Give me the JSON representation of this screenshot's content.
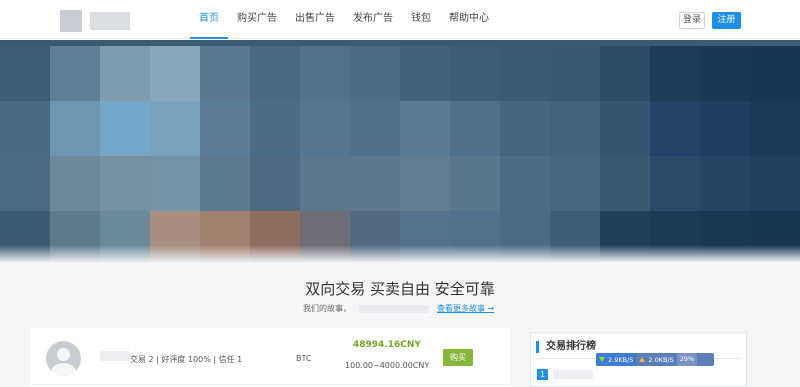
{
  "nav": {
    "items": [
      {
        "label": "首页",
        "active": true
      },
      {
        "label": "购买广告",
        "active": false
      },
      {
        "label": "出售广告",
        "active": false
      },
      {
        "label": "发布广告",
        "active": false
      },
      {
        "label": "钱包",
        "active": false
      },
      {
        "label": "帮助中心",
        "active": false
      }
    ],
    "login_label": "登录",
    "register_label": "注册"
  },
  "slogan": {
    "title": "双向交易 买卖自由 安全可靠",
    "subtitle_prefix": "我们的故事，",
    "more_link": "查看更多故事 →"
  },
  "ad": {
    "stats": "交易 2 | 好评度 100% | 信任 1",
    "coin": "BTC",
    "price": "48994.16CNY",
    "limit": "100.00~4000.00CNY",
    "buy_label": "购买"
  },
  "ranking": {
    "title": "交易排行榜",
    "first_rank": "1"
  },
  "speed_widget": {
    "download": "2.9KB/S",
    "upload": "2.0KB/S",
    "percent": "29%"
  },
  "colors": {
    "accent": "#1f8ee6",
    "price_green": "#74a520",
    "buy_button": "#87b63a"
  }
}
